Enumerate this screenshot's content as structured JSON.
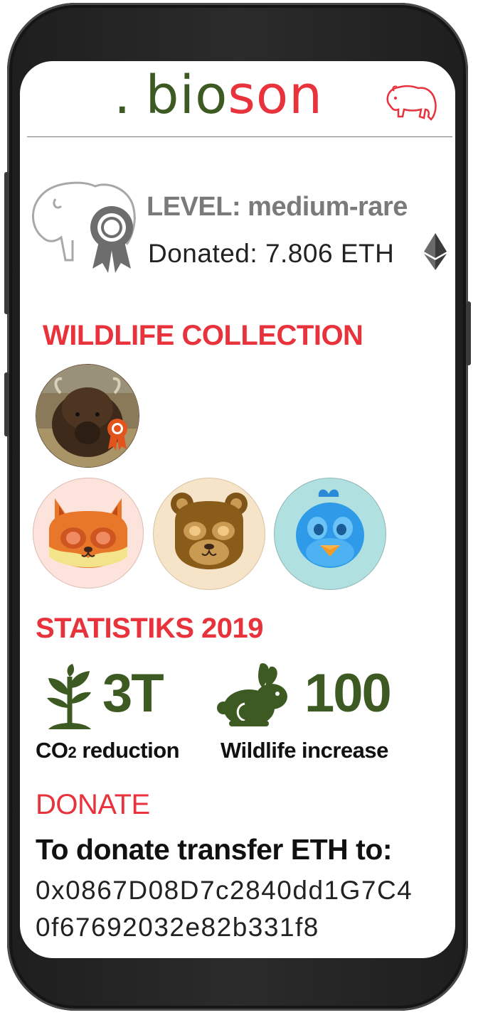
{
  "app": {
    "logo_dot": ".",
    "logo_bio": "bio",
    "logo_son": "son",
    "brand_green": "#3d5a22",
    "brand_red": "#e8323c"
  },
  "profile": {
    "level_label": "LEVEL: medium-rare",
    "donated_label": "Donated: 7.806 ETH",
    "currency_icon": "ethereum-icon",
    "badge_icon": "award-ribbon-icon"
  },
  "collection": {
    "title": "WILDLIFE COLLECTION",
    "featured": {
      "animal": "bison",
      "badge_icon": "award-ribbon-icon"
    },
    "items": [
      {
        "animal": "fox",
        "bg": "#fce3db"
      },
      {
        "animal": "bear",
        "bg": "#f6e4c9"
      },
      {
        "animal": "bird",
        "bg": "#b1e0e0"
      }
    ]
  },
  "statistics": {
    "title": "STATISTIKS 2019",
    "items": [
      {
        "icon": "plant-icon",
        "value": "3T",
        "label_main": "CO",
        "label_sub": "2",
        "label_rest": " reduction"
      },
      {
        "icon": "rabbit-icon",
        "value": "100",
        "label": "Wildlife increase"
      }
    ]
  },
  "donate": {
    "title": "DONATE",
    "instruction": "To donate transfer ETH to:",
    "address_line1": "0x0867D08D7c2840dd1G7C4",
    "address_line2": "0f67692032e82b331f8"
  }
}
